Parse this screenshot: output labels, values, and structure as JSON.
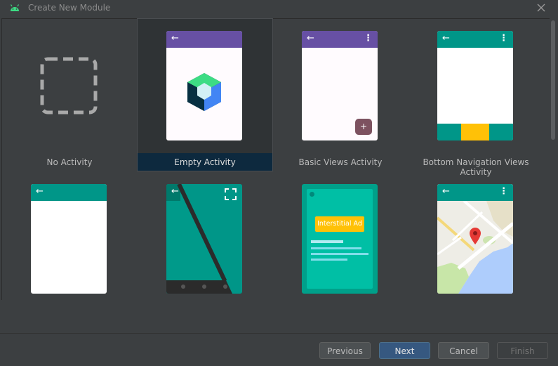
{
  "window": {
    "title": "Create New Module"
  },
  "templates": [
    {
      "label": "No Activity"
    },
    {
      "label": "Empty Activity"
    },
    {
      "label": "Basic Views Activity"
    },
    {
      "label": "Bottom Navigation Views Activity"
    },
    {
      "label": ""
    },
    {
      "label": ""
    },
    {
      "label": ""
    },
    {
      "label": ""
    }
  ],
  "selected_template": "Empty Activity",
  "interstitial": {
    "badge": "Interstitial Ad"
  },
  "buttons": {
    "previous": "Previous",
    "next": "Next",
    "cancel": "Cancel",
    "finish": "Finish"
  },
  "colors": {
    "accent_purple": "#6750a4",
    "accent_teal": "#009688",
    "nav_yellow": "#ffc107",
    "selection": "#0d293e",
    "primary_button": "#365880"
  }
}
